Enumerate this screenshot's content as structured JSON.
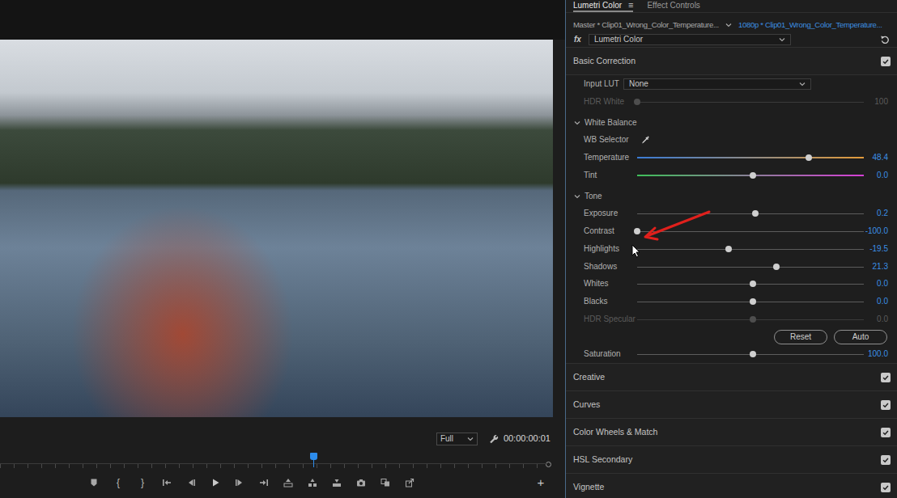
{
  "program_monitor": {
    "zoom": "Full",
    "timecode": "00:00:00:01",
    "playhead": {
      "level": 0.572
    },
    "transport": [
      {
        "kind": "marker"
      },
      {
        "kind": "glyph",
        "label": "{"
      },
      {
        "kind": "glyph",
        "label": "}"
      },
      {
        "kind": "goto-in"
      },
      {
        "kind": "step-back"
      },
      {
        "kind": "play"
      },
      {
        "kind": "step-forward"
      },
      {
        "kind": "goto-out"
      },
      {
        "kind": "lift"
      },
      {
        "kind": "extract"
      },
      {
        "kind": "overwrite"
      },
      {
        "kind": "camera"
      },
      {
        "kind": "compare"
      },
      {
        "kind": "export"
      }
    ],
    "add_button": "+"
  },
  "panel": {
    "tabs": [
      {
        "label": "Lumetri Color",
        "selected": true,
        "menu": "≡"
      },
      {
        "label": "Effect Controls",
        "selected": false
      }
    ],
    "master_clip": "Master * Clip01_Wrong_Color_Temperature...",
    "sequence_clip": "1080p * Clip01_Wrong_Color_Temperature...",
    "fx": "fx",
    "effect": "Lumetri Color",
    "sections": [
      {
        "title": "Basic Correction",
        "enabled": true,
        "controls": {
          "input_lut": {
            "label": "Input LUT",
            "value": "None"
          },
          "hdr_white": {
            "label": "HDR White",
            "value": "100",
            "level": 0,
            "kind": "plain",
            "disabled": true
          },
          "white_balance": {
            "label": "White Balance",
            "expanded": true,
            "selector": "WB Selector",
            "sliders": [
              {
                "label": "Temperature",
                "value": "48.4",
                "level": 0.756,
                "kind": "temperature",
                "disabled": false
              },
              {
                "label": "Tint",
                "value": "0.0",
                "level": 0.509,
                "kind": "tint",
                "disabled": false
              }
            ]
          },
          "tone": {
            "label": "Tone",
            "expanded": true,
            "sliders": [
              {
                "label": "Exposure",
                "value": "0.2",
                "level": 0.523,
                "kind": "plain",
                "disabled": false
              },
              {
                "label": "Contrast",
                "value": "-100.0",
                "level": 0,
                "kind": "plain",
                "disabled": false
              },
              {
                "label": "Highlights",
                "value": "-19.5",
                "level": 0.405,
                "kind": "plain",
                "disabled": false
              },
              {
                "label": "Shadows",
                "value": "21.3",
                "level": 0.613,
                "kind": "plain",
                "disabled": false
              },
              {
                "label": "Whites",
                "value": "0.0",
                "level": 0.509,
                "kind": "plain",
                "disabled": false
              },
              {
                "label": "Blacks",
                "value": "0.0",
                "level": 0.509,
                "kind": "plain",
                "disabled": false
              },
              {
                "label": "HDR Specular",
                "value": "0.0",
                "level": 0.509,
                "kind": "plain",
                "disabled": true
              }
            ],
            "buttons": [
              "Reset",
              "Auto"
            ]
          },
          "saturation": {
            "label": "Saturation",
            "value": "100.0",
            "level": 0.509,
            "kind": "plain",
            "disabled": false
          }
        }
      },
      {
        "title": "Creative",
        "enabled": true
      },
      {
        "title": "Curves",
        "enabled": true
      },
      {
        "title": "Color Wheels & Match",
        "enabled": true
      },
      {
        "title": "HSL Secondary",
        "enabled": true
      },
      {
        "title": "Vignette",
        "enabled": true
      }
    ]
  }
}
